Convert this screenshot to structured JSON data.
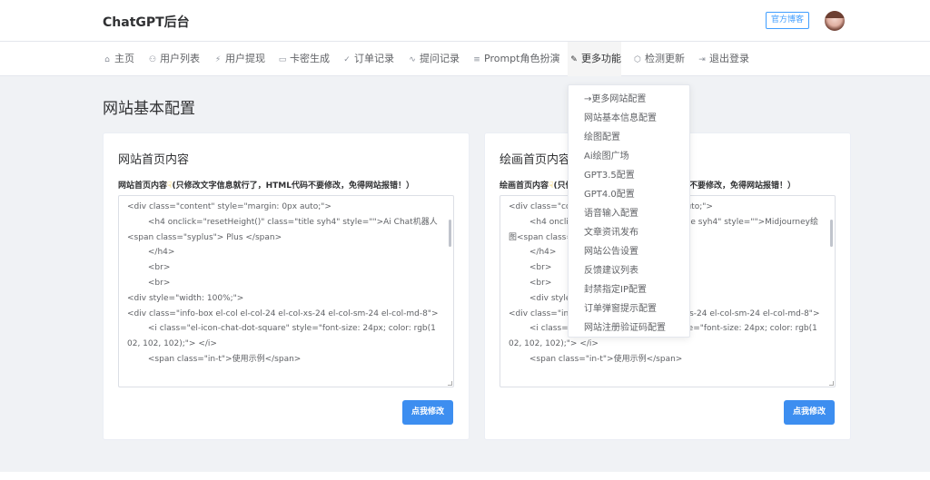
{
  "header": {
    "brand": "ChatGPT后台",
    "blog_button": "官方博客"
  },
  "nav": {
    "items": [
      {
        "icon": "⌂",
        "label": "主页"
      },
      {
        "icon": "⚇",
        "label": "用户列表"
      },
      {
        "icon": "⚡",
        "label": "用户提现"
      },
      {
        "icon": "▭",
        "label": "卡密生成"
      },
      {
        "icon": "✓",
        "label": "订单记录"
      },
      {
        "icon": "∿",
        "label": "提问记录"
      },
      {
        "icon": "≡",
        "label": "Prompt角色扮演"
      },
      {
        "icon": "✎",
        "label": "更多功能"
      },
      {
        "icon": "⬡",
        "label": "检测更新"
      },
      {
        "icon": "⇥",
        "label": "退出登录"
      }
    ]
  },
  "page_title": "网站基本配置",
  "cards": [
    {
      "title": "网站首页内容",
      "label_prefix": "网站首页内容",
      "label_suffix": "(只修改文字信息就行了，HTML代码不要修改，免得网站报错！）",
      "code_lines": [
        "<div class=\"content\" style=\"margin: 0px auto;\">",
        "        <h4 onclick=\"resetHeight()\" class=\"title syh4\" style=\"\">Ai Chat机器人 <span class=\"syplus\"> Plus </span>",
        "        </h4>",
        "        <br>",
        "        <br>",
        "<div style=\"width: 100%;\">",
        "<div class=\"info-box el-col el-col-24 el-col-xs-24 el-col-sm-24 el-col-md-8\">",
        "        <i class=\"el-icon-chat-dot-square\" style=\"font-size: 24px; color: rgb(102, 102, 102);\"> </i>",
        "        <span class=\"in-t\">使用示例</span>"
      ],
      "button": "点我修改"
    },
    {
      "title": "绘画首页内容",
      "label_prefix": "绘画首页内容",
      "label_suffix": "(只修改文字信息就行了，HTML代码不要修改，免得网站报错！）",
      "code_lines": [
        "<div class=\"content\" style=\"margin: 0px auto;\">",
        "        <h4 onclick=\"resetHeight()\" class=\"title syh4\" style=\"\">Midjourney绘图<span class=\"syplus\"> Plus </span>",
        "        </h4>",
        "        <br>",
        "        <br>",
        "        <div style=\"width: 100%;\">",
        "<div class=\"info-box el-col el-col-24 el-col-xs-24 el-col-sm-24 el-col-md-8\">",
        "        <i class=\"el-icon-chat-dot-square\" style=\"font-size: 24px; color: rgb(102, 102, 102);\"> </i>",
        "        <span class=\"in-t\">使用示例</span>"
      ],
      "button": "点我修改"
    }
  ],
  "dropdown": {
    "items": [
      "→更多网站配置",
      "网站基本信息配置",
      "绘图配置",
      "Ai绘图广场",
      "GPT3.5配置",
      "GPT4.0配置",
      "语音输入配置",
      "文章资讯发布",
      "网站公告设置",
      "反馈建议列表",
      "封禁指定IP配置",
      "订单弹窗提示配置",
      "网站注册验证码配置"
    ]
  },
  "colors": {
    "primary": "#409eff",
    "button": "#3d8ef0",
    "background": "#f0f2f5"
  }
}
